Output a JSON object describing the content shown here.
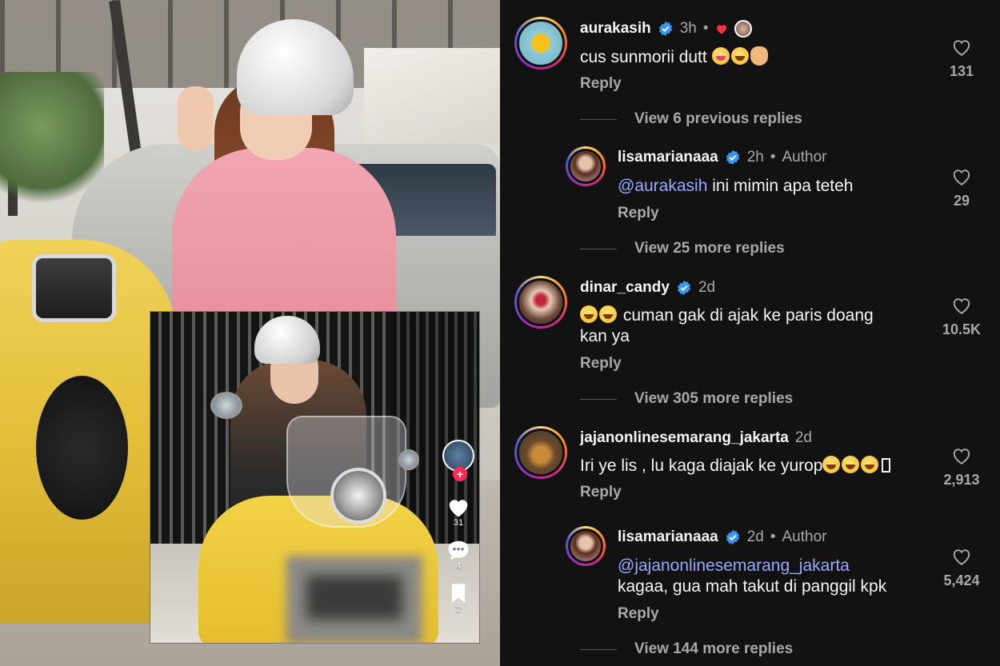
{
  "video_overlay": {
    "like_count": "31",
    "comment_count": "4",
    "save_count": "2"
  },
  "comments": [
    {
      "username": "aurakasih",
      "time": "3h",
      "text": "cus sunmorii dutt",
      "reply_label": "Reply",
      "likes": "131",
      "view_more": "View 6 previous replies"
    },
    {
      "username": "lisamarianaaa",
      "time": "2h",
      "author_label": "Author",
      "mention": "@aurakasih",
      "text": " ini mimin apa teteh",
      "reply_label": "Reply",
      "likes": "29",
      "view_more": "View 25 more replies"
    },
    {
      "username": "dinar_candy",
      "time": "2d",
      "text_line1": "cuman gak di ajak ke paris doang",
      "text_line2": "kan ya",
      "reply_label": "Reply",
      "likes": "10.5K",
      "view_more": "View 305 more replies"
    },
    {
      "username": "jajanonlinesemarang_jakarta",
      "time": "2d",
      "text": "Iri ye lis , lu kaga diajak ke yurop",
      "reply_label": "Reply",
      "likes": "2,913"
    },
    {
      "username": "lisamarianaaa",
      "time": "2d",
      "author_label": "Author",
      "mention": "@jajanonlinesemarang_jakarta",
      "text": "kagaa, gua mah takut di panggil kpk",
      "reply_label": "Reply",
      "likes": "5,424",
      "view_more": "View 144 more replies"
    }
  ],
  "colors": {
    "background": "#121212",
    "mention": "#9aa8ff",
    "verified": "#3897f0",
    "secondary_text": "#a8a8a8",
    "heart_red": "#ff3040"
  },
  "icons": [
    "verified-badge-icon",
    "heart-outline-icon",
    "heart-filled-icon",
    "comment-bubble-icon",
    "bookmark-icon",
    "plus-icon"
  ]
}
